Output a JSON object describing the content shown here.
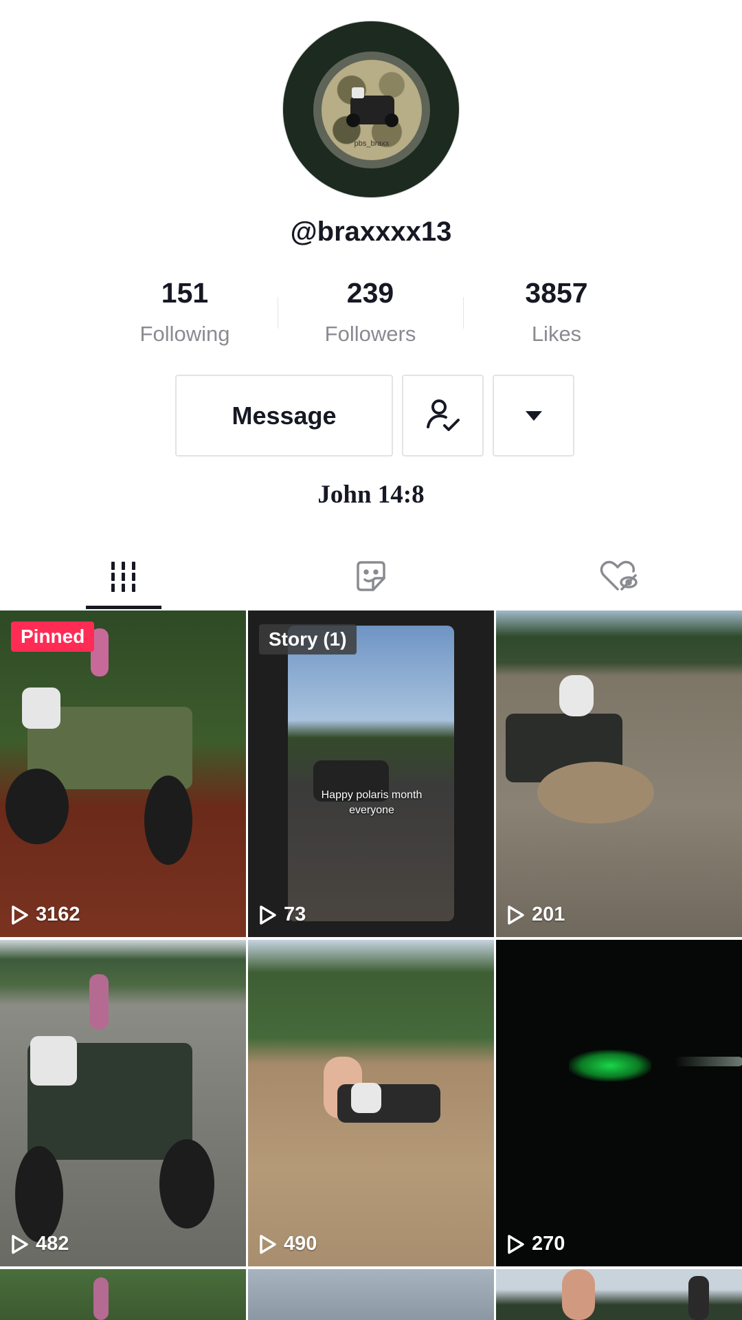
{
  "profile": {
    "avatar_text": "pbs_braxx",
    "username": "@braxxxx13",
    "bio": "John 14:8"
  },
  "stats": [
    {
      "value": "151",
      "label": "Following"
    },
    {
      "value": "239",
      "label": "Followers"
    },
    {
      "value": "3857",
      "label": "Likes"
    }
  ],
  "actions": {
    "message_label": "Message",
    "following_icon": "person-check-icon",
    "more_icon": "caret-down-icon"
  },
  "tabs": [
    {
      "name": "videos",
      "icon": "grid-icon",
      "active": true
    },
    {
      "name": "favorites",
      "icon": "sticker-icon",
      "active": false
    },
    {
      "name": "liked",
      "icon": "heart-hidden-icon",
      "active": false
    }
  ],
  "videos": [
    {
      "views": "3162",
      "badge": "Pinned"
    },
    {
      "views": "73",
      "badge": "Story (1)",
      "caption": "Happy polaris month everyone"
    },
    {
      "views": "201"
    },
    {
      "views": "482"
    },
    {
      "views": "490"
    },
    {
      "views": "270"
    }
  ],
  "colors": {
    "text": "#161823",
    "secondary": "#8a8b91",
    "pinned": "#fe2c55",
    "border": "#e3e3e4"
  }
}
